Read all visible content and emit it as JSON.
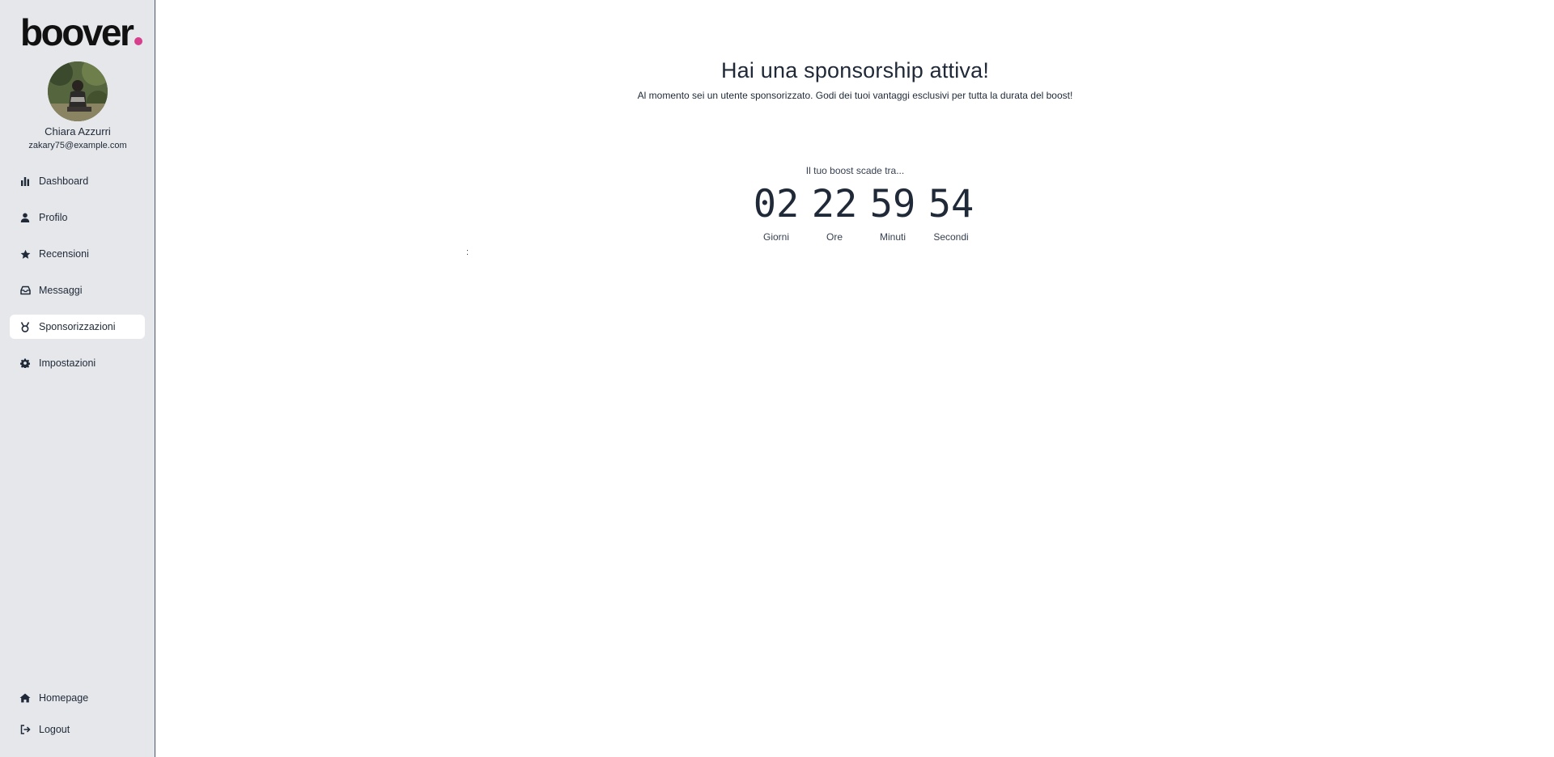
{
  "brand": {
    "logo_text": "boover",
    "accent_color": "#d63f8c"
  },
  "user": {
    "name": "Chiara Azzurri",
    "email": "zakary75@example.com"
  },
  "sidebar": {
    "items": [
      {
        "label": "Dashboard",
        "icon": "bar-chart-icon",
        "active": false
      },
      {
        "label": "Profilo",
        "icon": "user-icon",
        "active": false
      },
      {
        "label": "Recensioni",
        "icon": "star-icon",
        "active": false
      },
      {
        "label": "Messaggi",
        "icon": "inbox-icon",
        "active": false
      },
      {
        "label": "Sponsorizzazioni",
        "icon": "medal-icon",
        "active": true
      },
      {
        "label": "Impostazioni",
        "icon": "gear-icon",
        "active": false
      }
    ],
    "bottom_items": [
      {
        "label": "Homepage",
        "icon": "home-icon"
      },
      {
        "label": "Logout",
        "icon": "logout-icon"
      }
    ]
  },
  "main": {
    "title": "Hai una sponsorship attiva!",
    "subtitle": "Al momento sei un utente sponsorizzato. Godi dei tuoi vantaggi esclusivi per tutta la durata del boost!",
    "countdown_caption": "Il tuo boost scade tra...",
    "countdown": [
      {
        "value": "02",
        "label": "Giorni"
      },
      {
        "value": "22",
        "label": "Ore"
      },
      {
        "value": "59",
        "label": "Minuti"
      },
      {
        "value": "54",
        "label": "Secondi"
      }
    ],
    "stray_text": ":"
  }
}
